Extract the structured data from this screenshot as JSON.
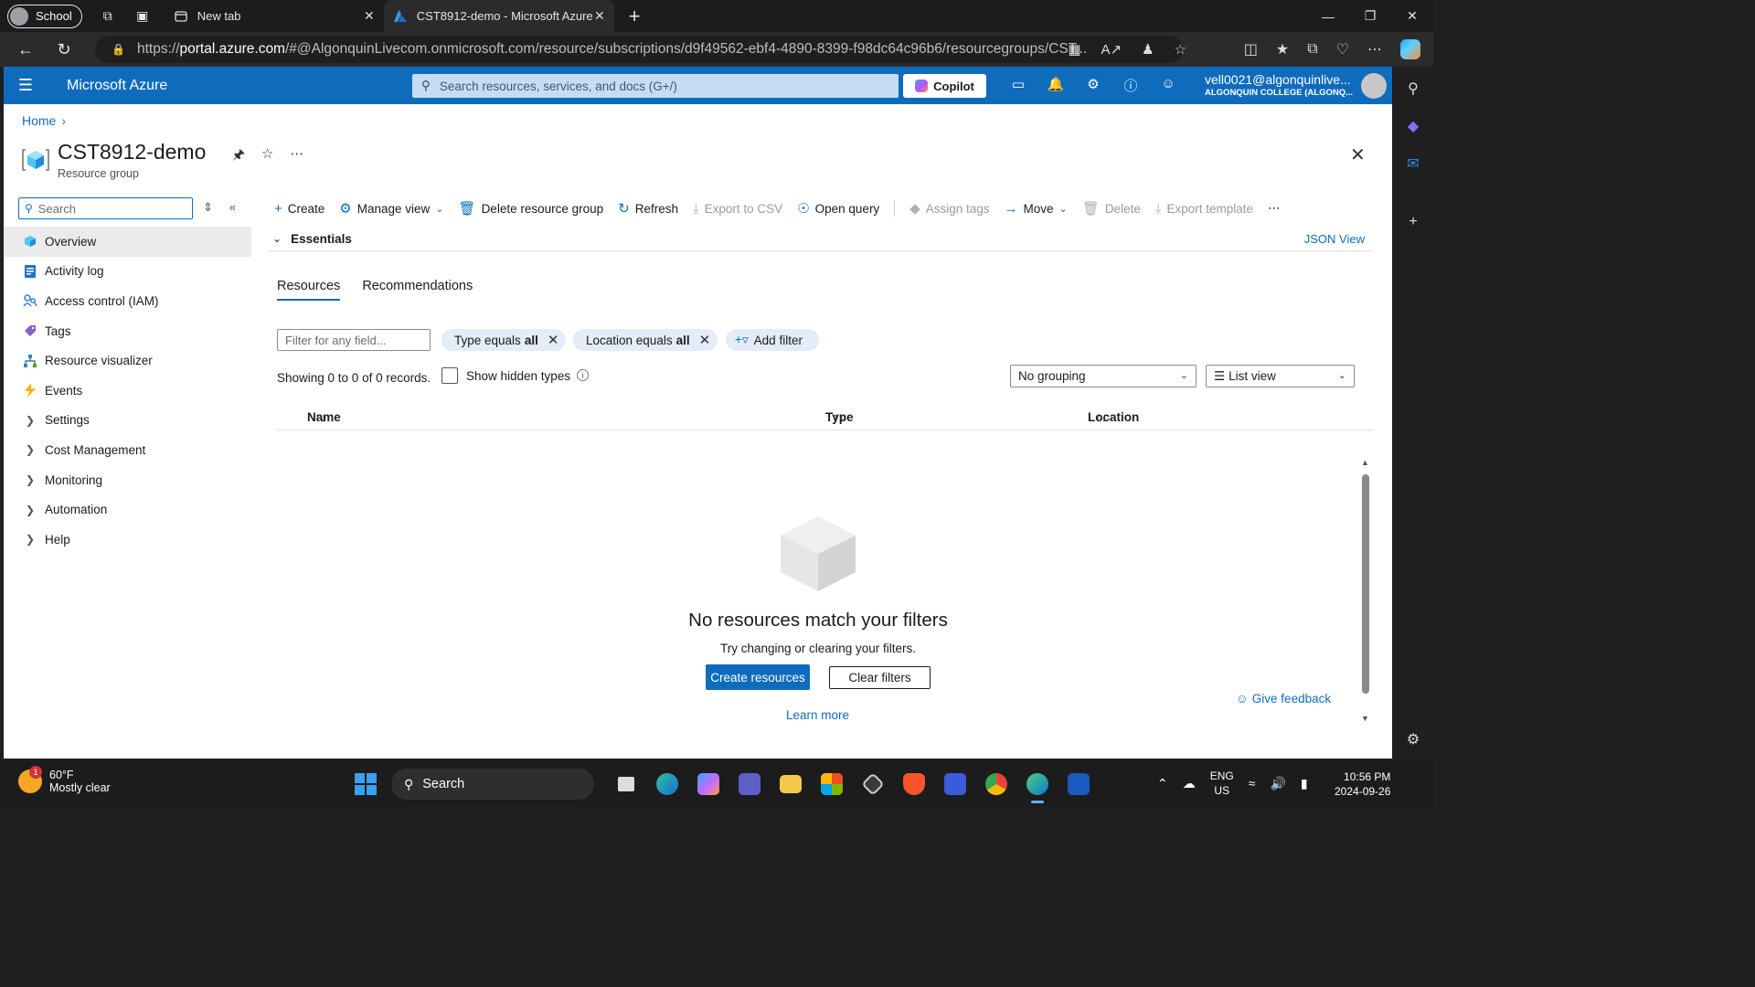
{
  "browser": {
    "profile_label": "School",
    "tabs": [
      {
        "label": "New tab",
        "icon": "new-tab-icon"
      },
      {
        "label": "CST8912-demo - Microsoft Azure",
        "icon": "azure-icon"
      }
    ],
    "url_prefix": "https://",
    "url_domain": "portal.azure.com",
    "url_rest": "/#@AlgonquinLivecom.onmicrosoft.com/resource/subscriptions/d9f49562-ebf4-4890-8399-f98dc64c96b6/resourcegroups/CST..."
  },
  "portal": {
    "brand": "Microsoft Azure",
    "search_placeholder": "Search resources, services, and docs (G+/)",
    "copilot_label": "Copilot",
    "user_email": "vell0021@algonquinlive...",
    "user_org": "ALGONQUIN COLLEGE (ALGONQ..."
  },
  "page": {
    "breadcrumb_home": "Home",
    "title": "CST8912-demo",
    "subtitle": "Resource group",
    "menu_search_placeholder": "Search"
  },
  "menu": {
    "items": [
      {
        "label": "Overview",
        "icon": "overview-icon",
        "active": true
      },
      {
        "label": "Activity log",
        "icon": "activity-log-icon"
      },
      {
        "label": "Access control (IAM)",
        "icon": "iam-icon"
      },
      {
        "label": "Tags",
        "icon": "tag-icon"
      },
      {
        "label": "Resource visualizer",
        "icon": "visualizer-icon"
      },
      {
        "label": "Events",
        "icon": "events-icon"
      }
    ],
    "groups": [
      "Settings",
      "Cost Management",
      "Monitoring",
      "Automation",
      "Help"
    ]
  },
  "commands": {
    "create": "Create",
    "manage_view": "Manage view",
    "delete_rg": "Delete resource group",
    "refresh": "Refresh",
    "export_csv": "Export to CSV",
    "open_query": "Open query",
    "assign_tags": "Assign tags",
    "move": "Move",
    "delete": "Delete",
    "export_template": "Export template"
  },
  "essentials": {
    "label": "Essentials",
    "json_view": "JSON View"
  },
  "content_tabs": [
    "Resources",
    "Recommendations"
  ],
  "filters": {
    "input_placeholder": "Filter for any field...",
    "type_prefix": "Type equals",
    "type_value": "all",
    "location_prefix": "Location equals",
    "location_value": "all",
    "add_filter": "Add filter"
  },
  "records": {
    "showing": "Showing 0 to 0 of 0 records.",
    "show_hidden": "Show hidden types",
    "grouping": "No grouping",
    "view": "List view"
  },
  "table": {
    "columns": [
      "Name",
      "Type",
      "Location"
    ]
  },
  "empty_state": {
    "title": "No resources match your filters",
    "subtitle": "Try changing or clearing your filters.",
    "create_button": "Create resources",
    "clear_button": "Clear filters",
    "learn_more": "Learn more",
    "give_feedback": "Give feedback"
  },
  "taskbar": {
    "temperature": "60°F",
    "weather": "Mostly clear",
    "weather_badge": "1",
    "search_label": "Search",
    "lang1": "ENG",
    "lang2": "US",
    "time": "10:56 PM",
    "date": "2024-09-26"
  },
  "colors": {
    "azure_blue": "#0f6cbd",
    "taskbar": "#1c1c1c"
  }
}
